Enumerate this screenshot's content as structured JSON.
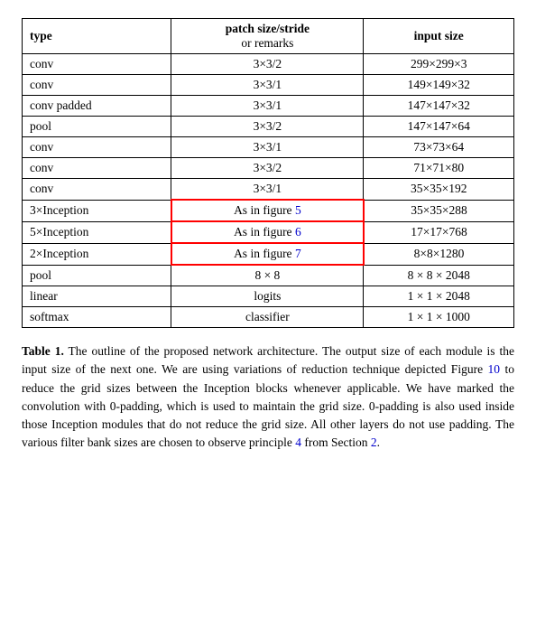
{
  "table": {
    "headers": [
      {
        "main": "type",
        "sub": ""
      },
      {
        "main": "patch size/stride",
        "sub": "or remarks"
      },
      {
        "main": "input size",
        "sub": ""
      }
    ],
    "rows": [
      {
        "type": "conv",
        "patch": "3×3/2",
        "input": "299×299×3"
      },
      {
        "type": "conv",
        "patch": "3×3/1",
        "input": "149×149×32"
      },
      {
        "type": "conv padded",
        "patch": "3×3/1",
        "input": "147×147×32"
      },
      {
        "type": "pool",
        "patch": "3×3/2",
        "input": "147×147×64"
      },
      {
        "type": "conv",
        "patch": "3×3/1",
        "input": "73×73×64"
      },
      {
        "type": "conv",
        "patch": "3×3/2",
        "input": "71×71×80"
      },
      {
        "type": "conv",
        "patch": "3×3/1",
        "input": "35×35×192"
      },
      {
        "type": "3×Inception",
        "patch": "As in figure 5",
        "input": "35×35×288",
        "highlight_patch": true
      },
      {
        "type": "5×Inception",
        "patch": "As in figure 6",
        "input": "17×17×768",
        "highlight_patch": true
      },
      {
        "type": "2×Inception",
        "patch": "As in figure 7",
        "input": "8×8×1280",
        "highlight_patch": true
      },
      {
        "type": "pool",
        "patch": "8 × 8",
        "input": "8 × 8 × 2048"
      },
      {
        "type": "linear",
        "patch": "logits",
        "input": "1 × 1 × 2048"
      },
      {
        "type": "softmax",
        "patch": "classifier",
        "input": "1 × 1 × 1000"
      }
    ]
  },
  "caption": {
    "label": "Table 1.",
    "text": " The outline of the proposed network architecture.  The output size of each module is the input size of the next one.  We are using variations of reduction technique depicted Figure ",
    "link1": "10",
    "text2": " to reduce the grid sizes between the Inception blocks whenever applicable.  We have marked the convolution with 0-padding, which is used to maintain the grid size.  0-padding is also used inside those Inception modules that do not reduce the grid size.  All other layers do not use padding.  The various filter bank sizes are chosen to observe principle ",
    "link2": "4",
    "text3": " from Section ",
    "link3": "2",
    "text4": "."
  }
}
